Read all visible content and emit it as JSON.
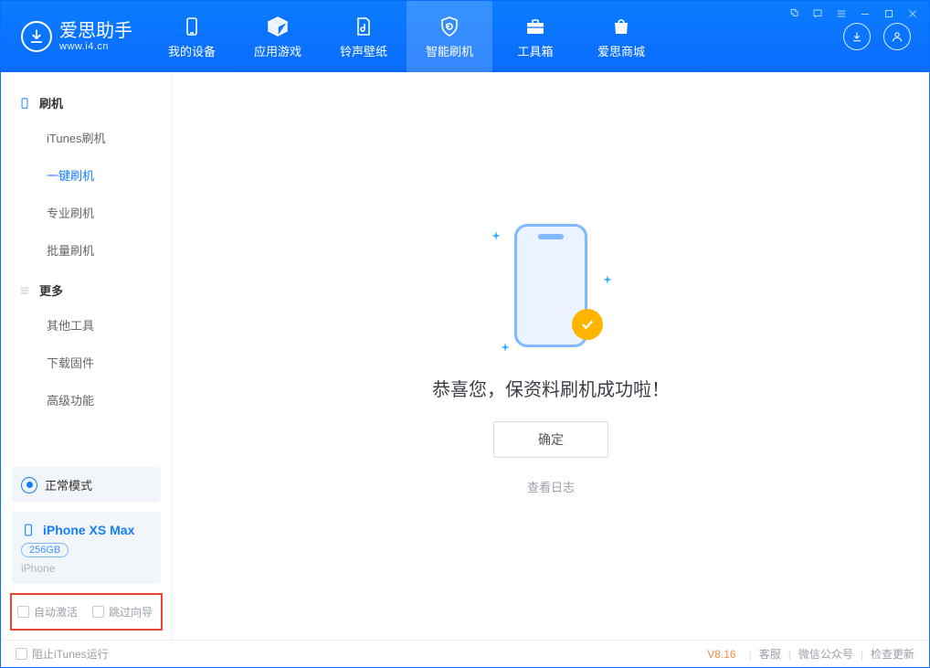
{
  "app": {
    "name": "爱思助手",
    "url": "www.i4.cn"
  },
  "tabs": {
    "device": "我的设备",
    "apps": "应用游戏",
    "ringtones": "铃声壁纸",
    "flash": "智能刷机",
    "toolbox": "工具箱",
    "store": "爱思商城"
  },
  "sidebar": {
    "group_flash": "刷机",
    "items_flash": {
      "itunes": "iTunes刷机",
      "oneclick": "一键刷机",
      "pro": "专业刷机",
      "batch": "批量刷机"
    },
    "group_more": "更多",
    "items_more": {
      "other": "其他工具",
      "firmware": "下载固件",
      "advanced": "高级功能"
    }
  },
  "device": {
    "mode": "正常模式",
    "name": "iPhone XS Max",
    "capacity": "256GB",
    "type": "iPhone"
  },
  "options": {
    "auto_activate": "自动激活",
    "skip_guide": "跳过向导"
  },
  "main": {
    "success": "恭喜您，保资料刷机成功啦！",
    "ok": "确定",
    "view_log": "查看日志"
  },
  "footer": {
    "block_itunes": "阻止iTunes运行",
    "version": "V8.16",
    "support": "客服",
    "wechat": "微信公众号",
    "update": "检查更新"
  }
}
